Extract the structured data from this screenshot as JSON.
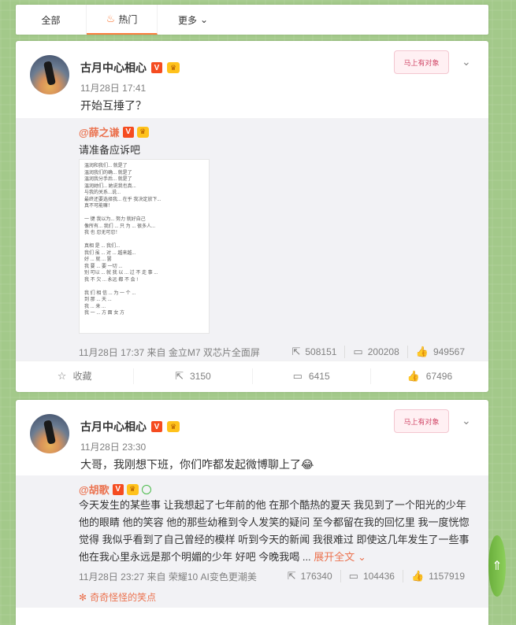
{
  "tabs": {
    "all": "全部",
    "hot": "热门",
    "more": "更多"
  },
  "posts": [
    {
      "author": "古月中心相心",
      "time": "11月28日 17:41",
      "text": "开始互捶了？",
      "sticker_text": "马上有对象",
      "repost": {
        "author": "@薛之谦",
        "text": "请准备应诉吧",
        "image_lines": [
          "温润和我们... 就是了",
          "温润我们的确... 就是了",
          "温润我分手后... 就是了",
          "温润她们... 她说我也真...",
          "与我的关系...说...",
          "最终还要选择我... 在乎 我决定放下...",
          "真不可能嘛！",
          "",
          "一 键 我以为... 努力 就好自己",
          "像所有... 我们 ... 只 为 ... 很多人...",
          "我 也 忍无可忍！",
          "",
          "真相 是 ... 我们...",
          "我们 虽 ... 对 ... 越来越...",
          "好 ... 就 ... 罢",
          "我 要 ... 要 一切 ...",
          "别 可以 ... 就 我 以 ... 过 不 走 事 ...",
          "我 不 欠 ... 永远 都 不 会 !",
          "",
          "我 们 相 信 ... 为 一 个 ...",
          "到 那 ... 天 ...",
          "我 ... 来 ...",
          "我 一 ... 方 面 女 方"
        ],
        "footer": "11月28日 17:37 来自 金立M7 双芯片全面屏",
        "reposts": "508151",
        "comments": "200208",
        "likes": "949567"
      },
      "actions": {
        "fav": "收藏",
        "repost": "3150",
        "comment": "6415",
        "like": "67496"
      }
    },
    {
      "author": "古月中心相心",
      "time": "11月28日 23:30",
      "text": "大哥，我刚想下班，你们咋都发起微博聊上了😂",
      "sticker_text": "马上有对象",
      "repost": {
        "author": "@胡歌",
        "text": "今天发生的某些事 让我想起了七年前的他 在那个酷热的夏天 我见到了一个阳光的少年 他的眼睛 他的笑容 他的那些幼稚到令人发笑的疑问 至今都留在我的回忆里 我一度恍惚觉得 我似乎看到了自己曾经的模样 听到今天的新闻 我很难过 即使这几年发生了一些事 他在我心里永远是那个明媚的少年 好吧 今晚我喝 ...",
        "expand": "展开全文",
        "footer": "11月28日 23:27 来自 荣耀10 AI变色更潮美",
        "reposts": "176340",
        "comments": "104436",
        "likes": "1157919",
        "tag": "奇奇怪怪的笑点"
      }
    }
  ],
  "icons": {
    "hot_tab": "flame-icon",
    "more_tab": "chevron-down-icon",
    "post_menu": "chevron-down-icon",
    "repost": "share-icon",
    "comment": "comment-icon",
    "like": "thumb-up-icon",
    "fav": "star-icon",
    "scroll_top": "arrow-up-icon"
  },
  "colors": {
    "accent": "#fa7d3c",
    "link": "#eb7350",
    "vip": "#f54c20",
    "background": "#a3c98a"
  }
}
